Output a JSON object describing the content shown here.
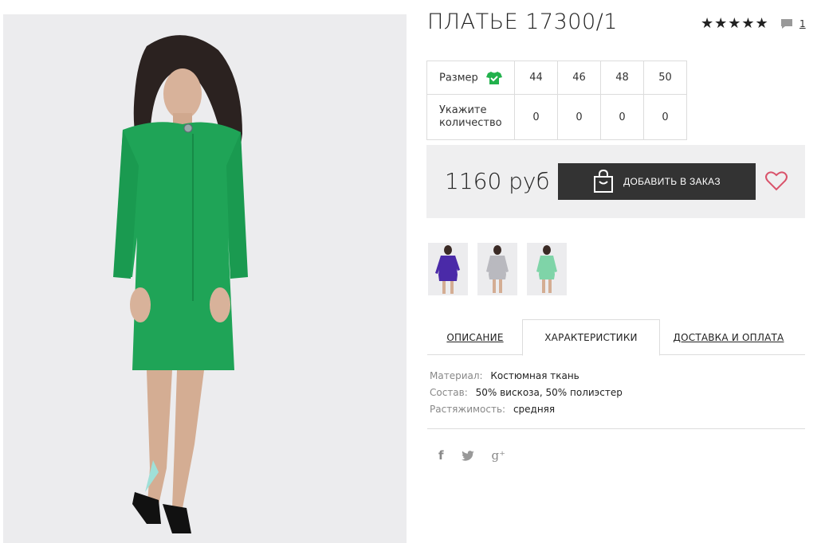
{
  "product": {
    "title": "ПЛАТЬЕ 17300/1",
    "rating_stars": "★★★★★",
    "comment_count": "1",
    "price": "1160 руб",
    "add_button_label": "ДОБАВИТЬ В ЗАКАЗ"
  },
  "sizes": {
    "size_row_label": "Размер",
    "qty_row_label_line1": "Укажите",
    "qty_row_label_line2": "количество",
    "options": [
      "44",
      "46",
      "48",
      "50"
    ],
    "quantities": [
      "0",
      "0",
      "0",
      "0"
    ]
  },
  "thumbnails": [
    {
      "name": "purple",
      "color": "#4a2aa8"
    },
    {
      "name": "grey",
      "color": "#b9b9bf"
    },
    {
      "name": "mint",
      "color": "#7fd4a8"
    }
  ],
  "tabs": [
    {
      "label": "ОПИСАНИЕ"
    },
    {
      "label": "ХАРАКТЕРИСТИКИ"
    },
    {
      "label": "ДОСТАВКА И ОПЛАТА"
    }
  ],
  "specs": [
    {
      "label": "Материал:",
      "value": "Костюмная ткань"
    },
    {
      "label": "Состав:",
      "value": "50% вискоза, 50% полиэстер"
    },
    {
      "label": "Растяжимость:",
      "value": "средняя"
    }
  ],
  "social": {
    "facebook": "f",
    "twitter": "🐦",
    "google": "g⁺"
  },
  "colors": {
    "dress": "#1fa457",
    "button_bg": "#333333",
    "buybox_bg": "#efeff0",
    "heart": "#d9536b",
    "tshirt_icon": "#22b14c"
  }
}
